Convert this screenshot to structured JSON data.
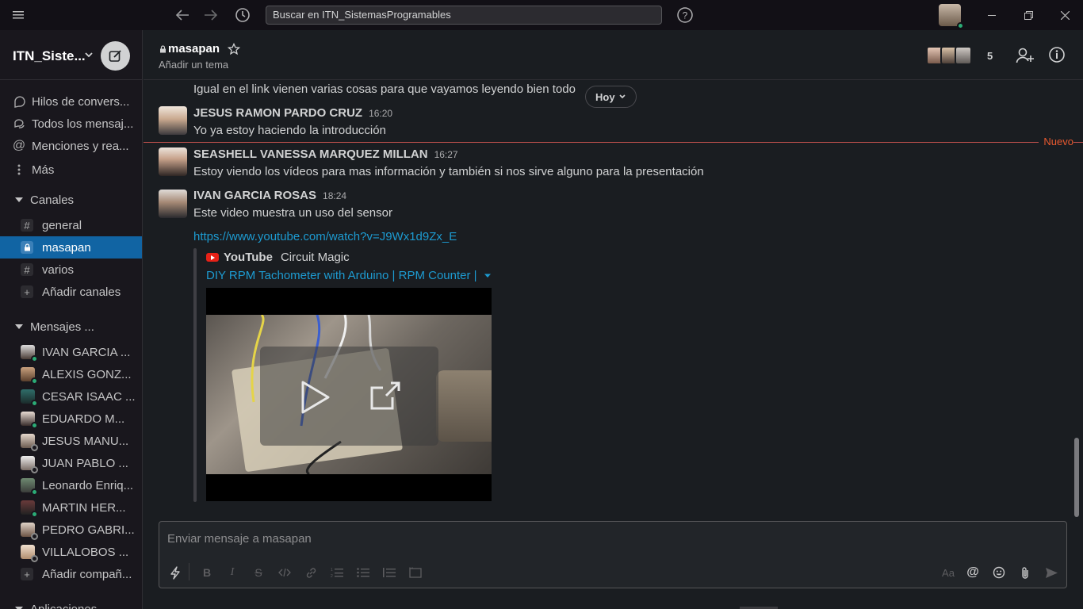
{
  "topbar": {
    "search_value": "Buscar en ITN_SistemasProgramables"
  },
  "sidebar": {
    "workspace_name": "ITN_Siste...",
    "nav": [
      {
        "label": "Hilos de convers..."
      },
      {
        "label": "Todos los mensaj..."
      },
      {
        "label": "Menciones y rea..."
      },
      {
        "label": "Más"
      }
    ],
    "channels_title": "Canales",
    "channels": [
      {
        "label": "general"
      },
      {
        "label": "masapan"
      },
      {
        "label": "varios"
      }
    ],
    "add_channels": "Añadir canales",
    "dms_title": "Mensajes ...",
    "dms": [
      {
        "label": "IVAN GARCIA ...",
        "status": "online"
      },
      {
        "label": "ALEXIS GONZ...",
        "status": "online"
      },
      {
        "label": "CESAR ISAAC ...",
        "status": "online"
      },
      {
        "label": "EDUARDO M...",
        "status": "online"
      },
      {
        "label": "JESUS MANU...",
        "status": "away"
      },
      {
        "label": "JUAN PABLO ...",
        "status": "away"
      },
      {
        "label": "Leonardo Enriq...",
        "status": "online"
      },
      {
        "label": "MARTIN HER...",
        "status": "online"
      },
      {
        "label": "PEDRO GABRI...",
        "status": "away"
      },
      {
        "label": "VILLALOBOS ...",
        "status": "away"
      }
    ],
    "add_teammates": "Añadir compañ...",
    "apps_partial": "Aplicaciones"
  },
  "channel": {
    "name": "masapan",
    "topic": "Añadir un tema",
    "member_count": "5"
  },
  "messages": {
    "prev_text": "Igual en el link vienen varias cosas para que vayamos leyendo bien todo",
    "date_pill": "Hoy",
    "new_label": "Nuevo",
    "items": [
      {
        "author": "JESUS RAMON PARDO CRUZ",
        "time": "16:20",
        "text": "Yo ya estoy haciendo la introducción"
      },
      {
        "author": "SEASHELL VANESSA MARQUEZ MILLAN",
        "time": "16:27",
        "text": "Estoy viendo los vídeos para mas información y también si nos sirve alguno para la presentación"
      },
      {
        "author": "IVAN GARCIA ROSAS",
        "time": "18:24",
        "text": "Este video muestra un uso del sensor"
      }
    ],
    "link": "https://www.youtube.com/watch?v=J9Wx1d9Zx_E",
    "attachment": {
      "service": "YouTube",
      "author": "Circuit Magic",
      "title": "DIY RPM Tachometer with Arduino | RPM Counter |"
    }
  },
  "composer": {
    "placeholder": "Enviar mensaje a masapan",
    "aa_label": "Aa"
  },
  "colors": {
    "accent": "#1164a3",
    "link": "#1d9bd1",
    "new_line": "#e8592f",
    "presence": "#2bac76"
  }
}
